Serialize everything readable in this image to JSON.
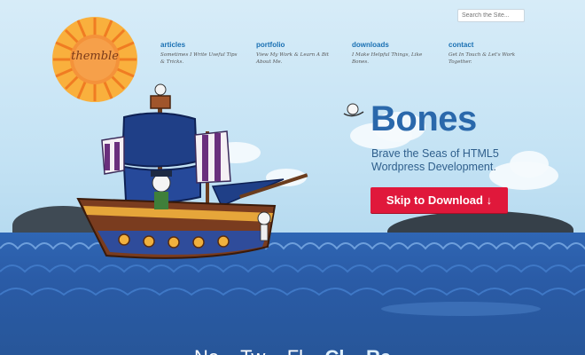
{
  "header": {
    "search": {
      "placeholder": "Search the Site..."
    },
    "logo": {
      "text": "themble"
    }
  },
  "nav": {
    "items": [
      {
        "label": "articles",
        "desc": "Sometimes I Write Useful Tips & Tricks."
      },
      {
        "label": "portfolio",
        "desc": "View My Work & Learn A Bit About Me."
      },
      {
        "label": "downloads",
        "desc": "I Make Helpful Things, Like Bones."
      },
      {
        "label": "contact",
        "desc": "Get In Touch & Let's Work Together."
      }
    ]
  },
  "hero": {
    "title": "Bones",
    "subtitle_line1": "Brave the Seas of HTML5",
    "subtitle_line2": "Wordpress Development.",
    "cta_label": "Skip to Download ↓"
  },
  "footer": {
    "tagline_part1": "Ne",
    "tagline_part2": "Tw",
    "tagline_part3": "Fl",
    "tagline_bold1": "Cl",
    "tagline_bold2": "Re"
  },
  "colors": {
    "accent": "#2a68ab",
    "cta": "#e0183b",
    "link": "#1a70b3",
    "sea": "#2f66b4",
    "sun": "#f2872a"
  }
}
